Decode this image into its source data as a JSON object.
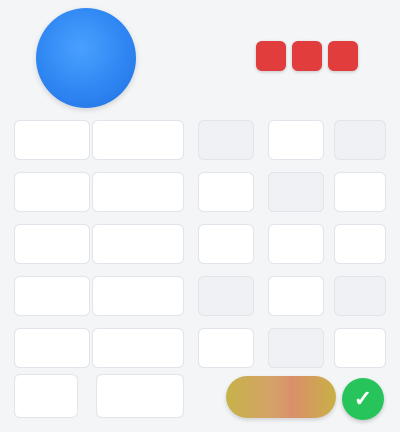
{
  "header": {
    "logo_icon": "app-logo-icon",
    "logo_glyph": "",
    "badge": {
      "glyphs": [
        "",
        "",
        ""
      ],
      "color": "#e23d3d"
    }
  },
  "grid": {
    "rows": [
      {
        "c1": "",
        "c2": "",
        "c3": "",
        "c4": "",
        "c5": ""
      },
      {
        "c1": "",
        "c2": "",
        "c3": "",
        "c4": "",
        "c5": ""
      },
      {
        "c1": "",
        "c2": "",
        "c3": "",
        "c4": "",
        "c5": ""
      },
      {
        "c1": "",
        "c2": "",
        "c3": "",
        "c4": "",
        "c5": ""
      },
      {
        "c1": "",
        "c2": "",
        "c3": "",
        "c4": "",
        "c5": ""
      }
    ]
  },
  "bottom": {
    "left_label": "",
    "mid_label": "",
    "action_label": "",
    "go_icon": "check-icon",
    "go_color": "#27c45c"
  }
}
